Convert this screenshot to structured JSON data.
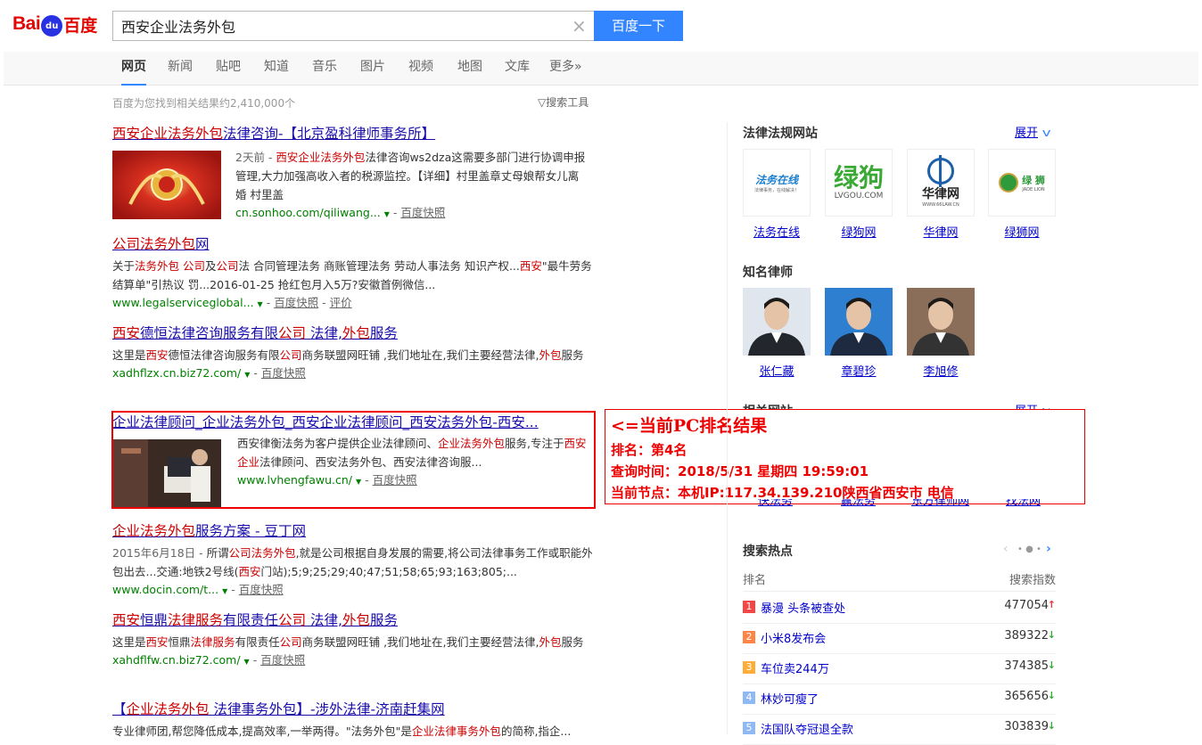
{
  "header": {
    "logo_left": "Bai",
    "logo_paw": "du",
    "logo_right": "百度",
    "query": "西安企业法务外包",
    "search_button": "百度一下"
  },
  "nav": {
    "tabs": [
      "网页",
      "新闻",
      "贴吧",
      "知道",
      "音乐",
      "图片",
      "视频",
      "地图",
      "文库",
      "更多»"
    ]
  },
  "meta": {
    "result_count": "百度为您找到相关结果约2,410,000个",
    "search_tools": "搜索工具"
  },
  "results": [
    {
      "title_parts": [
        {
          "t": "西安企业法务外包",
          "em": true
        },
        {
          "t": "法律咨询-【北京盈科律师事务所】",
          "em": false
        }
      ],
      "date": "2天前 - ",
      "abstract_parts": [
        {
          "t": "西安企业法务外包",
          "em": true
        },
        {
          "t": "法律咨询ws2dza这需要多部门进行协调申报管理,大力加强高收入者的税源监控。【详细】村里盖章丈母娘帮女儿离婚 村里盖",
          "em": false
        }
      ],
      "url": "cn.sonhoo.com/qiliwang...",
      "snapshot": "百度快照",
      "extra": ""
    },
    {
      "title_parts": [
        {
          "t": "公司法务外包",
          "em": true
        },
        {
          "t": "网",
          "em": false
        }
      ],
      "date": "",
      "abstract_parts": [
        {
          "t": "关于",
          "em": false
        },
        {
          "t": "法务外包",
          "em": true
        },
        {
          "t": " ",
          "em": false
        },
        {
          "t": "公司",
          "em": true
        },
        {
          "t": "及",
          "em": false
        },
        {
          "t": "公司",
          "em": true
        },
        {
          "t": "法 合同管理法务 商账管理法务 劳动人事法务 知识产权...",
          "em": false
        },
        {
          "t": "西安",
          "em": true
        },
        {
          "t": "\"最牛劳务结算单\"引热议 罚...2016-01-25 抢红包月入5万?安徽首例微信...",
          "em": false
        }
      ],
      "url": "www.legalserviceglobal...",
      "snapshot": "百度快照",
      "extra": "评价"
    },
    {
      "title_parts": [
        {
          "t": "西安",
          "em": true
        },
        {
          "t": "德恒法律咨询服务有限",
          "em": false
        },
        {
          "t": "公司",
          "em": true
        },
        {
          "t": " 法律,",
          "em": false
        },
        {
          "t": "外包",
          "em": true
        },
        {
          "t": "服务",
          "em": false
        }
      ],
      "date": "",
      "abstract_parts": [
        {
          "t": "这里是",
          "em": false
        },
        {
          "t": "西安",
          "em": true
        },
        {
          "t": "德恒法律咨询服务有限",
          "em": false
        },
        {
          "t": "公司",
          "em": true
        },
        {
          "t": "商务联盟网旺铺 ,我们地址在,我们主要经营法律,",
          "em": false
        },
        {
          "t": "外包",
          "em": true
        },
        {
          "t": "服务",
          "em": false
        }
      ],
      "url": "xadhflzx.cn.biz72.com/",
      "snapshot": "百度快照",
      "extra": ""
    },
    {
      "title_parts": [
        {
          "t": "企业法律顾问_企业法务外包_西安企业法律顾问_西安法务外包-西安...",
          "em": false
        }
      ],
      "date": "",
      "abstract_parts": [
        {
          "t": "西安律衡法务为客户提供企业法律顾问、",
          "em": false
        },
        {
          "t": "企业法务外包",
          "em": true
        },
        {
          "t": "服务,专注于",
          "em": false
        },
        {
          "t": "西安企业",
          "em": true
        },
        {
          "t": "法律顾问、西安法务外包、西安法律咨询服...",
          "em": false
        }
      ],
      "url": "www.lvhengfawu.cn/",
      "snapshot": "百度快照",
      "extra": ""
    },
    {
      "title_parts": [
        {
          "t": "企业法务外包",
          "em": true
        },
        {
          "t": "服务方案 - 豆丁网",
          "em": false
        }
      ],
      "date": "2015年6月18日 - ",
      "abstract_parts": [
        {
          "t": "所谓",
          "em": false
        },
        {
          "t": "公司法务外包",
          "em": true
        },
        {
          "t": ",就是公司根据自身发展的需要,将公司法律事务工作或职能外包出去...交通:地铁2号线(",
          "em": false
        },
        {
          "t": "西安",
          "em": true
        },
        {
          "t": "门站);5;9;25;29;40;47;51;58;65;93;163;805;...",
          "em": false
        }
      ],
      "url": "www.docin.com/t...",
      "snapshot": "百度快照",
      "extra": ""
    },
    {
      "title_parts": [
        {
          "t": "西安",
          "em": true
        },
        {
          "t": "恒鼎",
          "em": false
        },
        {
          "t": "法律服务",
          "em": true
        },
        {
          "t": "有限责任",
          "em": false
        },
        {
          "t": "公司",
          "em": true
        },
        {
          "t": " 法律,",
          "em": false
        },
        {
          "t": "外包",
          "em": true
        },
        {
          "t": "服务",
          "em": false
        }
      ],
      "date": "",
      "abstract_parts": [
        {
          "t": "这里是",
          "em": false
        },
        {
          "t": "西安",
          "em": true
        },
        {
          "t": "恒鼎",
          "em": false
        },
        {
          "t": "法律服务",
          "em": true
        },
        {
          "t": "有限责任",
          "em": false
        },
        {
          "t": "公司",
          "em": true
        },
        {
          "t": "商务联盟网旺铺 ,我们地址在,我们主要经营法律,",
          "em": false
        },
        {
          "t": "外包",
          "em": true
        },
        {
          "t": "服务",
          "em": false
        }
      ],
      "url": "xahdflfw.cn.biz72.com/",
      "snapshot": "百度快照",
      "extra": ""
    },
    {
      "title_parts": [
        {
          "t": "【",
          "em": false
        },
        {
          "t": "企业法务外包",
          "em": true
        },
        {
          "t": " 法律事务外包】-涉外法律-济南赶集网",
          "em": false
        }
      ],
      "date": "",
      "abstract_parts": [
        {
          "t": "专业律师团,帮您降低成本,提高效率,一举两得。\"法务外包\"是",
          "em": false
        },
        {
          "t": "企业法律事务外包",
          "em": true
        },
        {
          "t": "的简称,指企...",
          "em": false
        }
      ],
      "url": "",
      "snapshot": "",
      "extra": ""
    }
  ],
  "info_box": {
    "line1": "<=当前PC排名结果",
    "line2": "排名：第4名",
    "line3": "查询时间：2018/5/31 星期四 19:59:01",
    "line4": "当前节点：本机IP:117.34.139.210陕西省西安市 电信"
  },
  "sidebar": {
    "law_sites": {
      "title": "法律法规网站",
      "toggle": "展开",
      "items": [
        {
          "name": "法务在线",
          "logo_text": "法务在线",
          "logo_sub": "法律事务，在线解决！",
          "color": "#1a7fd0"
        },
        {
          "name": "绿狗网",
          "logo_text": "绿狗",
          "logo_sub": "LVGOU.COM",
          "color": "#3aa935"
        },
        {
          "name": "华律网",
          "logo_text": "华律网",
          "logo_sub": "WWW.66LAW.CN",
          "color": "#1f5fa8"
        },
        {
          "name": "绿狮网",
          "logo_text": "绿 狮",
          "logo_sub": "JADE LION",
          "color": "#2f9a3c"
        }
      ]
    },
    "lawyers": {
      "title": "知名律师",
      "items": [
        {
          "name": "张仁藏"
        },
        {
          "name": "章碧珍"
        },
        {
          "name": "李旭修"
        }
      ]
    },
    "related": {
      "title_partial": "相关网站",
      "toggle": "展开",
      "names_partial": [
        "快法务",
        "赢法务",
        "东方律师网",
        "找法网"
      ]
    },
    "hot": {
      "title": "搜索热点",
      "col_rank": "排名",
      "col_index": "搜索指数",
      "rows": [
        {
          "rank": "1",
          "kw": "暴漫 头条被查处",
          "val": "477054",
          "trend": "up",
          "color": "#f54545"
        },
        {
          "rank": "2",
          "kw": "小米8发布会",
          "val": "389322",
          "trend": "down",
          "color": "#ff8547"
        },
        {
          "rank": "3",
          "kw": "车位卖244万",
          "val": "374385",
          "trend": "down",
          "color": "#ffac38"
        },
        {
          "rank": "4",
          "kw": "林妙可瘦了",
          "val": "365656",
          "trend": "down",
          "color": "#8eb9f5"
        },
        {
          "rank": "5",
          "kw": "法国队夺冠退全款",
          "val": "303839",
          "trend": "down",
          "color": "#8eb9f5"
        }
      ]
    }
  }
}
